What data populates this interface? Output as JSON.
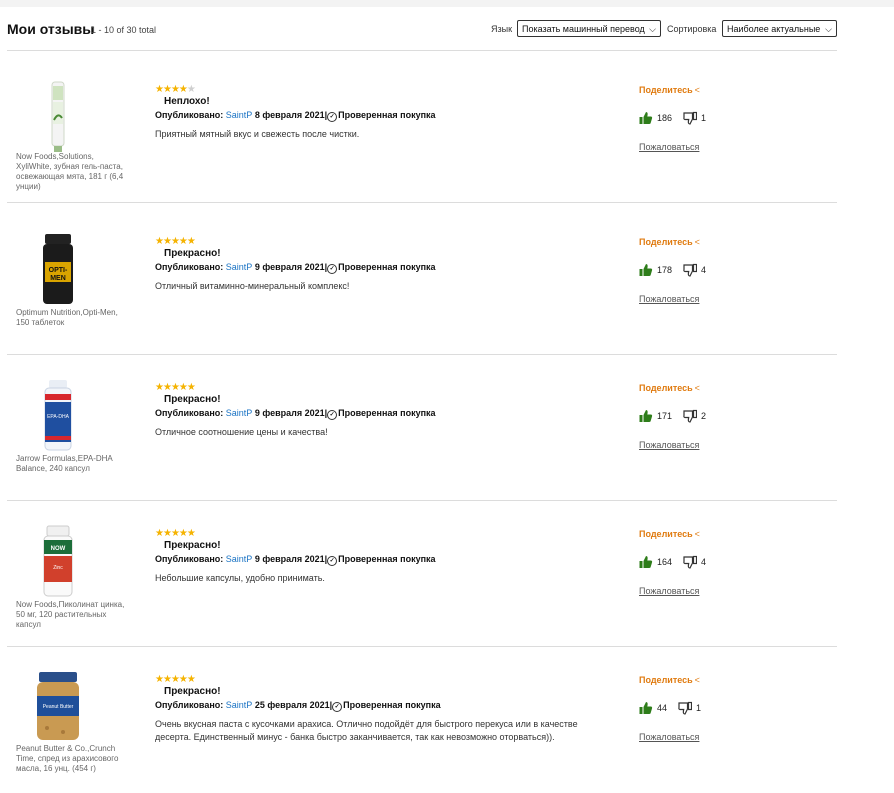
{
  "header": {
    "title": "Мои отзывы",
    "range": "1 - 10 of 30 total",
    "language_label": "Язык",
    "language_value": "Показать машинный перевод",
    "sort_label": "Сортировка",
    "sort_value": "Наиболее актуальные"
  },
  "colors": {
    "accent": "#e07b10",
    "link": "#1a73c4",
    "star": "#f5b301",
    "thumb": "#2e7d1a"
  },
  "icons": {
    "share": "share-icon",
    "up": "thumbs-up-icon",
    "down": "thumbs-down-icon",
    "verified": "check-circle-icon"
  },
  "reviews": [
    {
      "product": "Now Foods,Solutions, XyliWhite, зубная гель-паста, освежающая мята, 181 г (6,4 унции)",
      "rating": 4,
      "title": "Неплохо!",
      "published_label": "Опубликовано:",
      "author": "SaintP",
      "date": "8 февраля 2021",
      "verified": "Проверенная покупка",
      "text": "Приятный мятный вкус и свежесть после чистки.",
      "share": "Поделитесь",
      "up": "186",
      "down": "1",
      "report": "Пожаловаться"
    },
    {
      "product": "Optimum Nutrition,Opti-Men, 150 таблеток",
      "rating": 5,
      "title": "Прекрасно!",
      "published_label": "Опубликовано:",
      "author": "SaintP",
      "date": "9 февраля 2021",
      "verified": "Проверенная покупка",
      "text": "Отличный витаминно-минеральный комплекс!",
      "share": "Поделитесь",
      "up": "178",
      "down": "4",
      "report": "Пожаловаться"
    },
    {
      "product": "Jarrow Formulas,EPA-DHA Balance, 240 капсул",
      "rating": 5,
      "title": "Прекрасно!",
      "published_label": "Опубликовано:",
      "author": "SaintP",
      "date": "9 февраля 2021",
      "verified": "Проверенная покупка",
      "text": "Отличное соотношение цены и качества!",
      "share": "Поделитесь",
      "up": "171",
      "down": "2",
      "report": "Пожаловаться"
    },
    {
      "product": "Now Foods,Пиколинат цинка, 50 мг, 120 растительных капсул",
      "rating": 5,
      "title": "Прекрасно!",
      "published_label": "Опубликовано:",
      "author": "SaintP",
      "date": "9 февраля 2021",
      "verified": "Проверенная покупка",
      "text": "Небольшие капсулы, удобно принимать.",
      "share": "Поделитесь",
      "up": "164",
      "down": "4",
      "report": "Пожаловаться"
    },
    {
      "product": "Peanut Butter & Co.,Crunch Time, спред из арахисового масла, 16 унц. (454 г)",
      "rating": 5,
      "title": "Прекрасно!",
      "published_label": "Опубликовано:",
      "author": "SaintP",
      "date": "25 февраля 2021",
      "verified": "Проверенная покупка",
      "text": "Очень вкусная паста с кусочками арахиса. Отлично подойдёт для быстрого перекуса или в качестве десерта. Единственный минус - банка быстро заканчивается, так как невозможно оторваться)).",
      "share": "Поделитесь",
      "up": "44",
      "down": "1",
      "report": "Пожаловаться"
    }
  ]
}
